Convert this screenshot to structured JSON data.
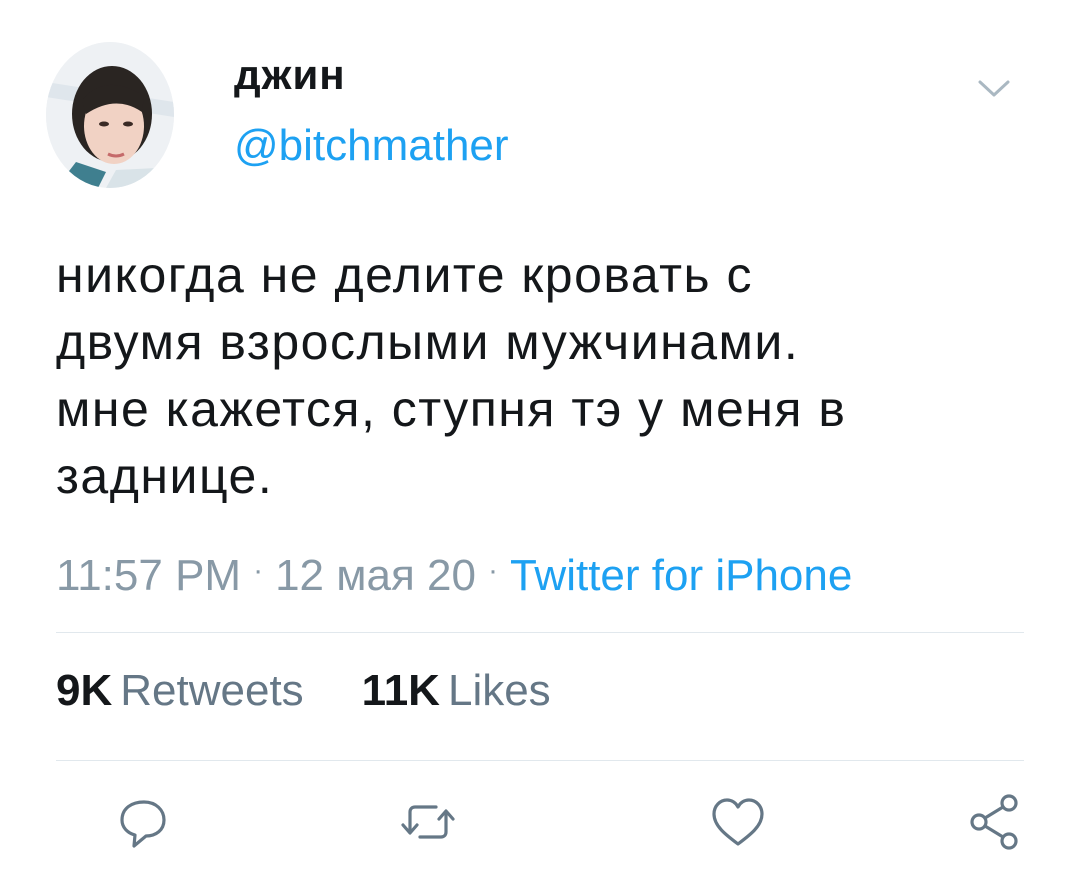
{
  "author": {
    "display_name": "джин",
    "handle": "@bitchmather"
  },
  "tweet": {
    "text_lines": [
      "никогда не делите кровать с",
      "двумя взрослыми мужчинами.",
      "мне кажется, ступня тэ у меня в",
      "заднице."
    ],
    "time": "11:57 PM",
    "date": "12 мая 20",
    "source": "Twitter for iPhone",
    "separator": "·"
  },
  "stats": {
    "retweets_count": "9K",
    "retweets_label": "Retweets",
    "likes_count": "11K",
    "likes_label": "Likes"
  },
  "icons": {
    "menu": "chevron-down-icon",
    "reply": "reply-icon",
    "retweet": "retweet-icon",
    "like": "heart-icon",
    "share": "share-icon"
  },
  "colors": {
    "link": "#1da1f2",
    "muted": "#8899a6",
    "text": "#14171a",
    "icon": "#657786"
  }
}
